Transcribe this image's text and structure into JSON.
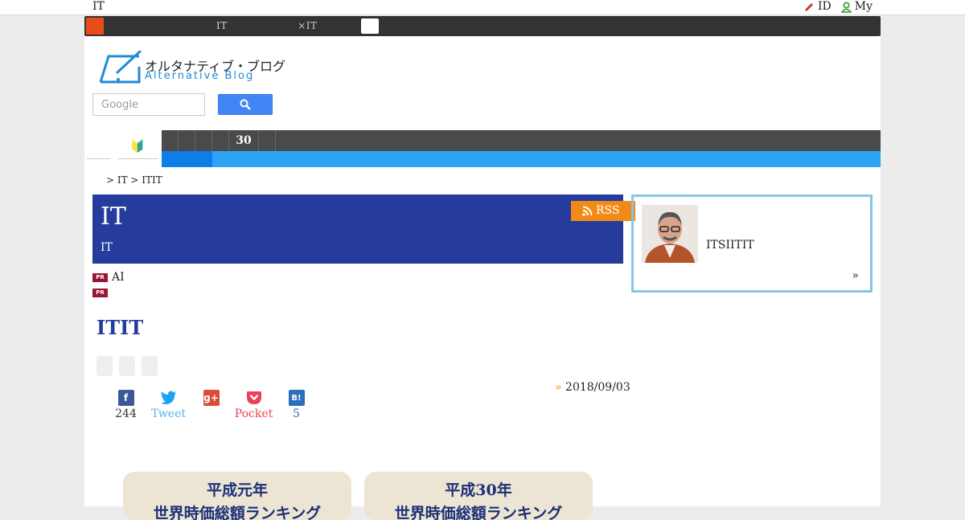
{
  "topbar": {
    "site_label": "IT",
    "id_label": "ID",
    "my_label": "My"
  },
  "ticker": {
    "text": "　　　　　　　　　　　　IT　　　　　　　×IT　　　　　　　　　　　　　　　",
    "button_label": "　　"
  },
  "logo": {
    "jp": "オルタナティブ・ブログ",
    "en": "Alternative Blog"
  },
  "search": {
    "placeholder": "Google"
  },
  "nav": {
    "beginner_icon": "🔰",
    "cells": [
      "",
      "",
      "",
      "",
      "30",
      "",
      ""
    ]
  },
  "breadcrumb": "> IT > ITIT",
  "blog": {
    "title": "IT",
    "subtitle": "IT",
    "rss_label": "RSS"
  },
  "profile": {
    "description": "ITSIITIT",
    "more_label": "»"
  },
  "pr": [
    {
      "tag": "PR",
      "text": "AI"
    },
    {
      "tag": "PR",
      "text": ""
    }
  ],
  "entry": {
    "title": "ITIT",
    "date_mark": "»",
    "date": "2018/09/03"
  },
  "share": [
    {
      "icon": "facebook-icon",
      "glyph": "f",
      "color": "#3b5998",
      "label": "244",
      "label_color": "#333"
    },
    {
      "icon": "twitter-icon",
      "glyph": "t",
      "color": "#1da1f2",
      "label": "Tweet",
      "label_color": "#55acee"
    },
    {
      "icon": "google-plus-icon",
      "glyph": "g+",
      "color": "#dd4b39",
      "label": "",
      "label_color": "#333"
    },
    {
      "icon": "pocket-icon",
      "glyph": "v",
      "color": "#ef4056",
      "label": "Pocket",
      "label_color": "#ef4056"
    },
    {
      "icon": "hatena-bookmark-icon",
      "glyph": "B!",
      "color": "#2c6ebd",
      "label": "5",
      "label_color": "#2c6ebd"
    }
  ],
  "thumbnails": [
    {
      "line1": "平成元年",
      "line2": "世界時価総額ランキング"
    },
    {
      "line1": "平成30年",
      "line2": "世界時価総額ランキング"
    }
  ]
}
